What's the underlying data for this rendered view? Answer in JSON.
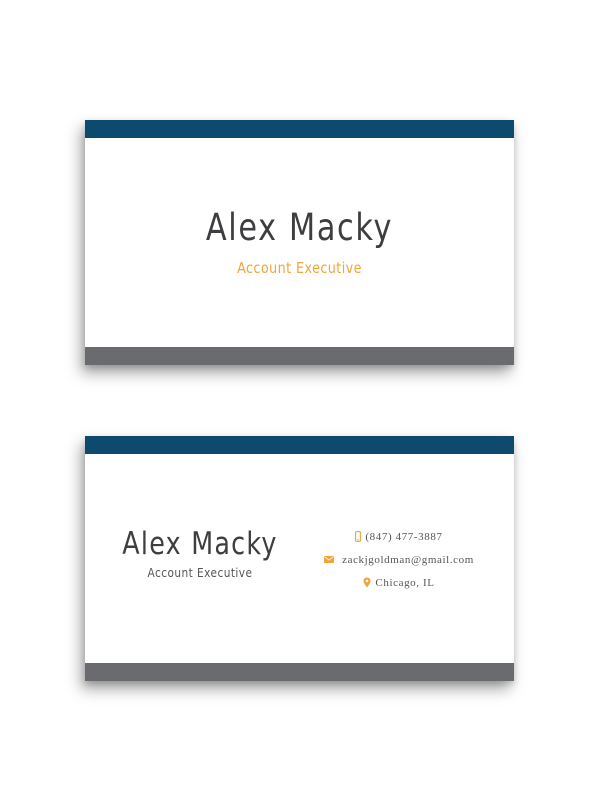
{
  "colors": {
    "top_band": "#0d4a6e",
    "bottom_band": "#6a6b6f",
    "accent": "#f2a43a",
    "name_text": "#3e3e40",
    "body_text": "#555558"
  },
  "front": {
    "name": "Alex Macky",
    "title": "Account Executive"
  },
  "back": {
    "name": "Alex Macky",
    "title": "Account Executive",
    "contacts": {
      "phone": {
        "icon": "phone-icon",
        "text": "(847) 477-3887"
      },
      "email": {
        "icon": "envelope-icon",
        "text": "zackjgoldman@gmail.com"
      },
      "location": {
        "icon": "map-pin-icon",
        "text": "Chicago, IL"
      }
    }
  }
}
